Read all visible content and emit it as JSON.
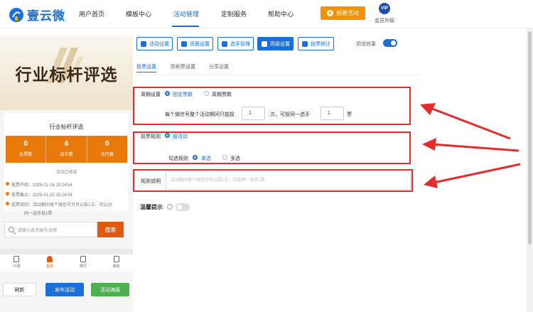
{
  "logo": {
    "text": "壹云微"
  },
  "nav": {
    "items": [
      "用户首页",
      "模板中心",
      "活动管理",
      "定制服务",
      "帮助中心"
    ],
    "active_index": 2,
    "create_button": "创建活动",
    "vip_badge": "VIP",
    "vip_label": "会员升级"
  },
  "preview": {
    "banner_title": "行业标杆评选",
    "card_title": "行业标杆评选",
    "stats": [
      {
        "value": "0",
        "label": "总票数"
      },
      {
        "value": "6",
        "label": "选手数"
      },
      {
        "value": "0",
        "label": "访问量"
      }
    ],
    "status_text": "活动已结束",
    "info": [
      "投票开始：2025-01-16 15:24:54",
      "投票截止：2025-01-22 15:24:54",
      "投票规则：活动期间每个微信号只可以投1次，可以对",
      "同一选手投1票"
    ],
    "search_placeholder": "请输入选手编号/名称",
    "search_button": "搜索",
    "tabbar": [
      "介绍",
      "投票",
      "排行",
      "报名"
    ],
    "tabbar_active_index": 1,
    "actions": {
      "refresh": "刷新",
      "publish": "发布活动",
      "poster": "活动海报"
    },
    "colors": {
      "accent": "#e97a0a",
      "publish": "#1a6fd8",
      "poster": "#4caf50"
    }
  },
  "toolbar": {
    "buttons": [
      "活动设置",
      "页面设置",
      "选手管理",
      "高级设置",
      "投票统计"
    ],
    "active_index": 3,
    "preview_label": "预览效果",
    "preview_on": true
  },
  "subtabs": {
    "items": [
      "投票设置",
      "防刷票设置",
      "分享设置"
    ],
    "active_index": 0
  },
  "settings": {
    "cycle": {
      "label": "周期设置",
      "options": [
        "固定票数",
        "周期票数"
      ],
      "selected": 0,
      "text_before": "每个微信号整个活动期间只能投",
      "votes_value": "1",
      "text_middle": "次，可投同一选手",
      "same_value": "1",
      "text_after": "票"
    },
    "rule": {
      "label": "投票规则",
      "options": [
        "按活动"
      ],
      "selected": 0,
      "check_label": "勾选规则",
      "check_options": [
        "单选",
        "多选"
      ],
      "check_selected": 0
    },
    "description": {
      "label": "规则说明",
      "placeholder": "活动期间每个微信号可以投1次，可投同一选手1票"
    },
    "tip": {
      "label": "温馨提示",
      "help": "?",
      "enabled": false
    }
  },
  "annotation_color": "#e52c2c"
}
